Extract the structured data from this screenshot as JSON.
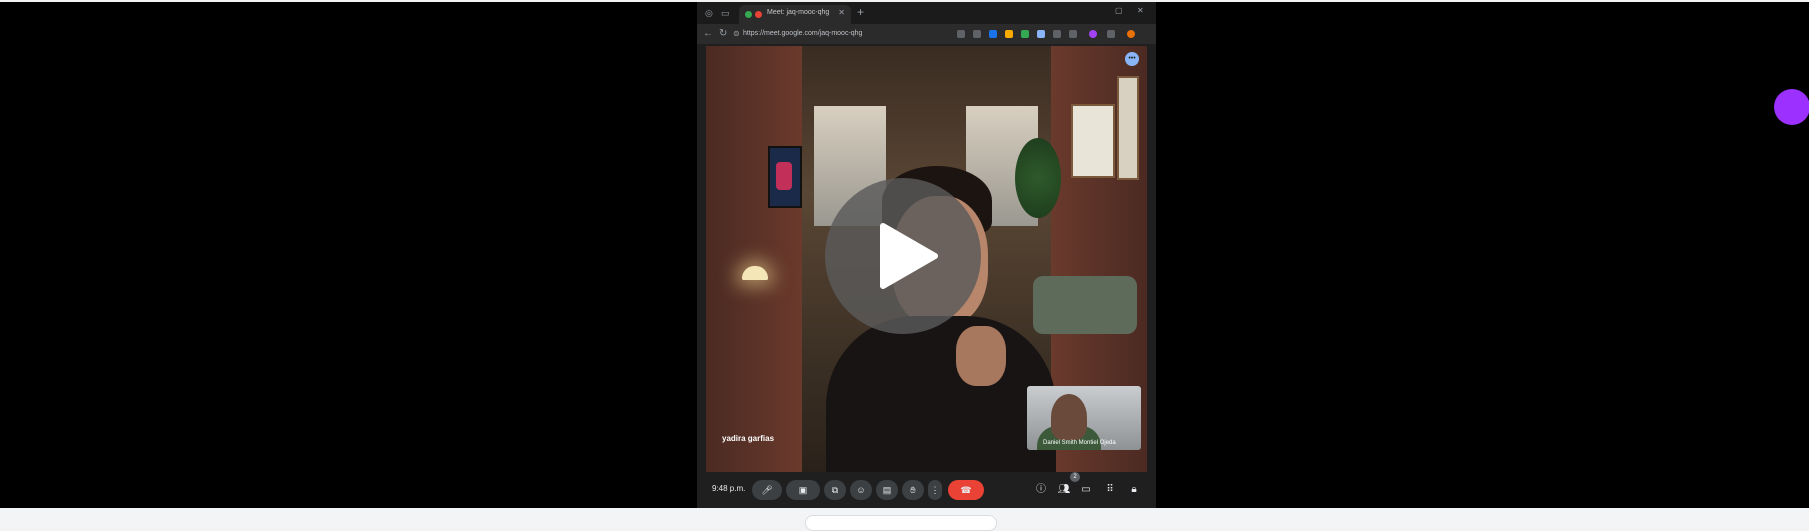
{
  "browser": {
    "tab_title": "Meet: jaq-mooc-qhg",
    "url": "https://meet.google.com/jaq-mooc-qhg"
  },
  "meeting": {
    "speaker_name": "yadira garfias",
    "self_view_name": "Daniel Smith Montiel Ojeda",
    "clock": "9:48 p.m.",
    "participants_count": "2"
  },
  "icons": {
    "play": "play-icon",
    "mic": "microphone-icon",
    "camera": "camera-icon",
    "present": "present-screen-icon",
    "emoji": "emoji-icon",
    "captions": "captions-icon",
    "hand": "raise-hand-icon",
    "more": "more-options-icon",
    "leave": "leave-call-icon",
    "info": "info-icon",
    "people": "people-icon",
    "chat": "chat-icon",
    "activities": "activities-icon",
    "host": "host-controls-icon"
  },
  "colors": {
    "player_background": "#000000",
    "leave_button": "#ea4335",
    "accent_dot": "#9b30ff"
  }
}
